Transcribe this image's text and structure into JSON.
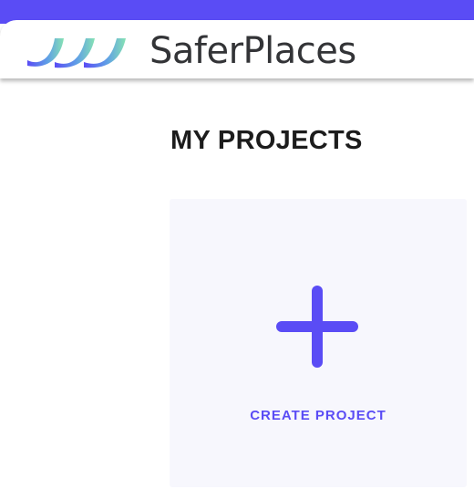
{
  "brand": {
    "name": "SaferPlaces",
    "accent_color": "#5a4cf5"
  },
  "logo_icon": "wave-logo-icon",
  "page": {
    "title": "MY PROJECTS"
  },
  "create_card": {
    "icon": "plus-icon",
    "label": "CREATE PROJECT"
  }
}
